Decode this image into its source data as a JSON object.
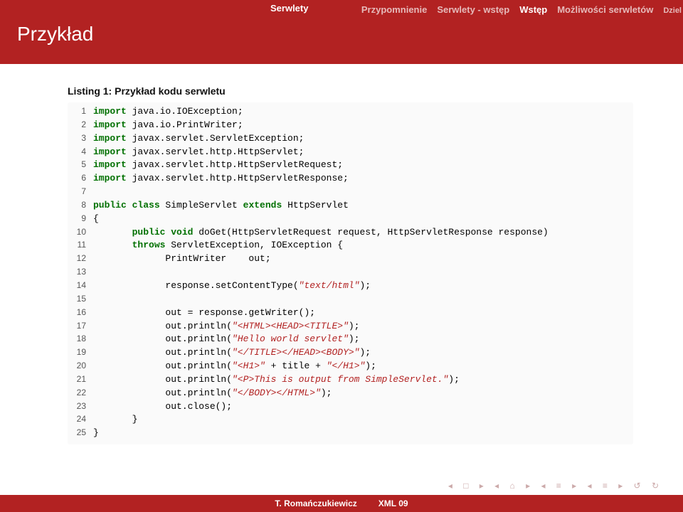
{
  "header": {
    "section_current": "Serwlety",
    "nav": [
      "Przypomnienie",
      "Serwlety - wstęp",
      "Wstęp",
      "Możliwości serwletów",
      "Dziel"
    ],
    "title": "Przykład"
  },
  "listing_caption": "Listing 1: Przykład kodu serwletu",
  "code": [
    {
      "n": "1",
      "seg": [
        {
          "t": "import",
          "c": "kw"
        },
        {
          "t": " java.io.IOException;"
        }
      ]
    },
    {
      "n": "2",
      "seg": [
        {
          "t": "import",
          "c": "kw"
        },
        {
          "t": " java.io.PrintWriter;"
        }
      ]
    },
    {
      "n": "3",
      "seg": [
        {
          "t": "import",
          "c": "kw"
        },
        {
          "t": " javax.servlet.ServletException;"
        }
      ]
    },
    {
      "n": "4",
      "seg": [
        {
          "t": "import",
          "c": "kw"
        },
        {
          "t": " javax.servlet.http.HttpServlet;"
        }
      ]
    },
    {
      "n": "5",
      "seg": [
        {
          "t": "import",
          "c": "kw"
        },
        {
          "t": " javax.servlet.http.HttpServletRequest;"
        }
      ]
    },
    {
      "n": "6",
      "seg": [
        {
          "t": "import",
          "c": "kw"
        },
        {
          "t": " javax.servlet.http.HttpServletResponse;"
        }
      ]
    },
    {
      "n": "7",
      "seg": []
    },
    {
      "n": "8",
      "seg": [
        {
          "t": "public class",
          "c": "kw"
        },
        {
          "t": " SimpleServlet "
        },
        {
          "t": "extends",
          "c": "kw"
        },
        {
          "t": " HttpServlet"
        }
      ]
    },
    {
      "n": "9",
      "seg": [
        {
          "t": "{"
        }
      ]
    },
    {
      "n": "10",
      "seg": [
        {
          "t": "       "
        },
        {
          "t": "public void",
          "c": "kw"
        },
        {
          "t": " doGet(HttpServletRequest request, HttpServletResponse response)"
        }
      ]
    },
    {
      "n": "11",
      "seg": [
        {
          "t": "       "
        },
        {
          "t": "throws",
          "c": "kw"
        },
        {
          "t": " ServletException, IOException {"
        }
      ]
    },
    {
      "n": "12",
      "seg": [
        {
          "t": "             PrintWriter    out;"
        }
      ]
    },
    {
      "n": "13",
      "seg": []
    },
    {
      "n": "14",
      "seg": [
        {
          "t": "             response.setContentType("
        },
        {
          "t": "\"text/html\"",
          "c": "str"
        },
        {
          "t": ");"
        }
      ]
    },
    {
      "n": "15",
      "seg": []
    },
    {
      "n": "16",
      "seg": [
        {
          "t": "             out = response.getWriter();"
        }
      ]
    },
    {
      "n": "17",
      "seg": [
        {
          "t": "             out.println("
        },
        {
          "t": "\"<HTML><HEAD><TITLE>\"",
          "c": "str"
        },
        {
          "t": ");"
        }
      ]
    },
    {
      "n": "18",
      "seg": [
        {
          "t": "             out.println("
        },
        {
          "t": "\"Hello world servlet\"",
          "c": "str"
        },
        {
          "t": ");"
        }
      ]
    },
    {
      "n": "19",
      "seg": [
        {
          "t": "             out.println("
        },
        {
          "t": "\"</TITLE></HEAD><BODY>\"",
          "c": "str"
        },
        {
          "t": ");"
        }
      ]
    },
    {
      "n": "20",
      "seg": [
        {
          "t": "             out.println("
        },
        {
          "t": "\"<H1>\"",
          "c": "str"
        },
        {
          "t": " + title + "
        },
        {
          "t": "\"</H1>\"",
          "c": "str"
        },
        {
          "t": ");"
        }
      ]
    },
    {
      "n": "21",
      "seg": [
        {
          "t": "             out.println("
        },
        {
          "t": "\"<P>This is output from SimpleServlet.\"",
          "c": "str"
        },
        {
          "t": ");"
        }
      ]
    },
    {
      "n": "22",
      "seg": [
        {
          "t": "             out.println("
        },
        {
          "t": "\"</BODY></HTML>\"",
          "c": "str"
        },
        {
          "t": ");"
        }
      ]
    },
    {
      "n": "23",
      "seg": [
        {
          "t": "             out.close();"
        }
      ]
    },
    {
      "n": "24",
      "seg": [
        {
          "t": "       }"
        }
      ]
    },
    {
      "n": "25",
      "seg": [
        {
          "t": "}"
        }
      ]
    }
  ],
  "footer": {
    "author": "T. Romańczukiewicz",
    "doc": "XML 09"
  },
  "navicons": "◂ □ ▸ ◂ ⌂ ▸ ◂ ≡ ▸ ◂ ≡ ▸   ↺ ↻"
}
